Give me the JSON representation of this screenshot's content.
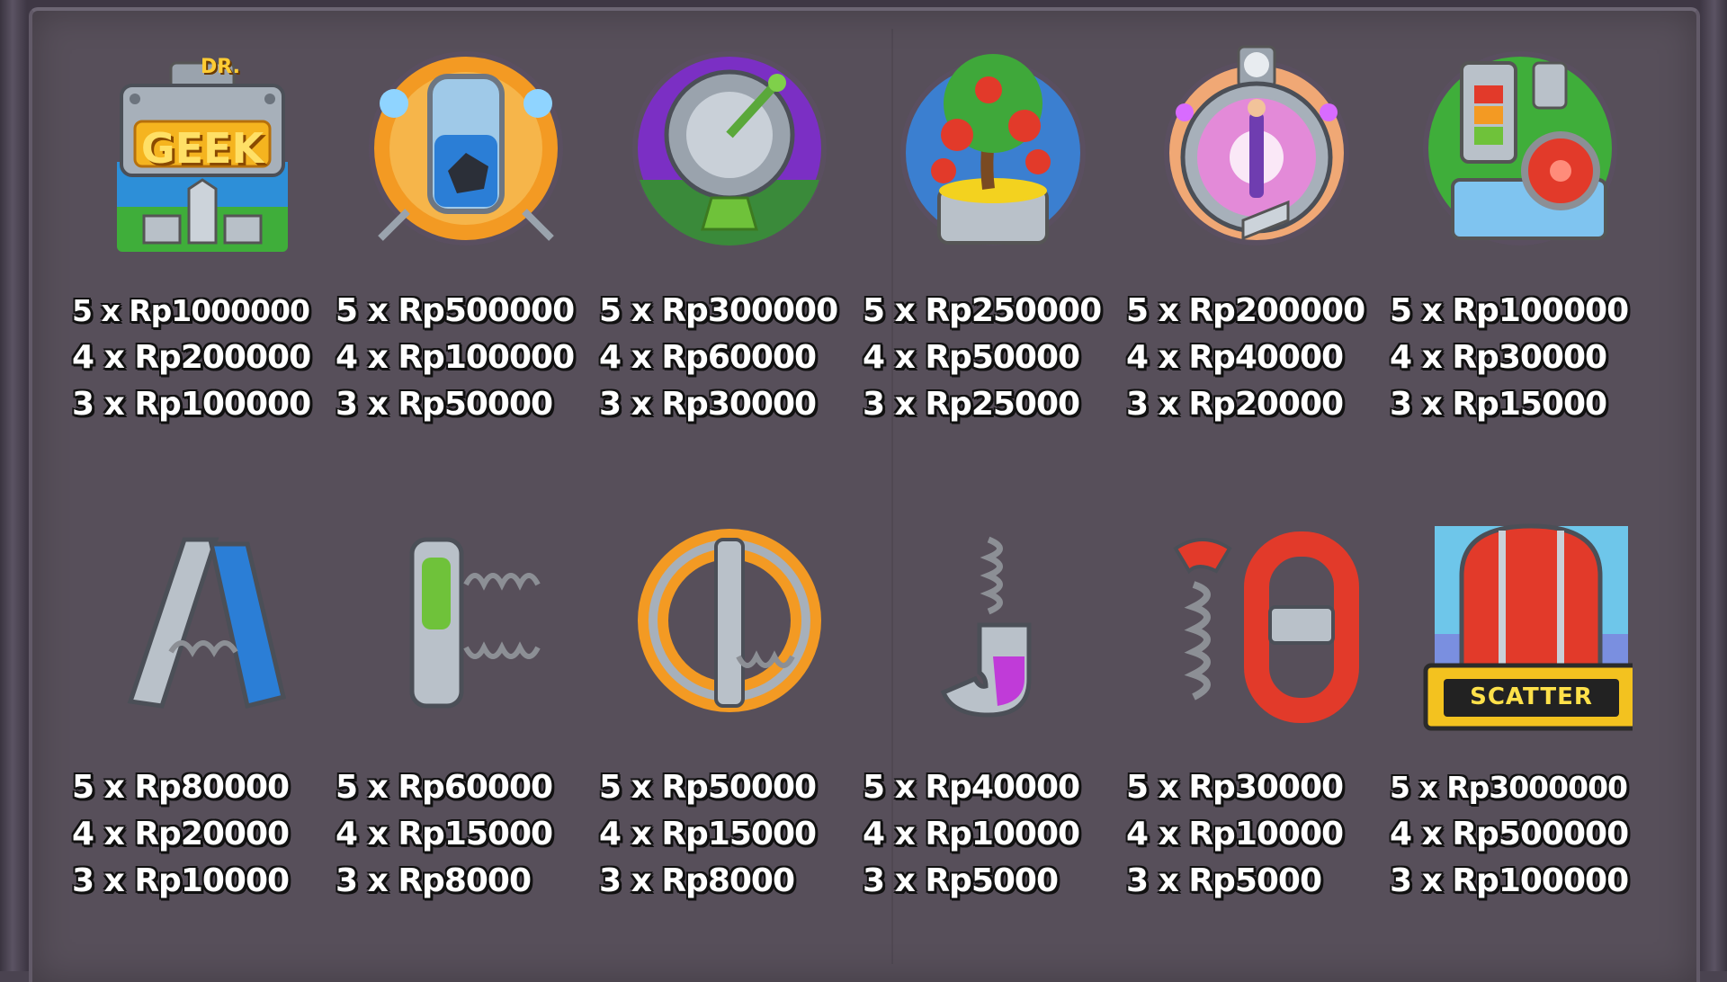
{
  "symbols_row1": [
    {
      "icon": "dr-geek-wild-icon",
      "logo_text": [
        "DR.",
        "GEEK"
      ],
      "pays": [
        "5 x Rp1000000",
        "4 x Rp200000",
        "3 x Rp100000"
      ]
    },
    {
      "icon": "specimen-jar-icon",
      "pays": [
        "5 x Rp500000",
        "4 x Rp100000",
        "3 x Rp50000"
      ]
    },
    {
      "icon": "satellite-dish-icon",
      "pays": [
        "5 x Rp300000",
        "4 x Rp60000",
        "3 x Rp30000"
      ]
    },
    {
      "icon": "tomato-plant-icon",
      "pays": [
        "5 x Rp250000",
        "4 x Rp50000",
        "3 x Rp25000"
      ]
    },
    {
      "icon": "teleporter-icon",
      "pays": [
        "5 x Rp200000",
        "4 x Rp40000",
        "3 x Rp20000"
      ]
    },
    {
      "icon": "battery-machine-icon",
      "pays": [
        "5 x Rp100000",
        "4 x Rp30000",
        "3 x Rp15000"
      ]
    }
  ],
  "symbols_row2": [
    {
      "icon": "letter-a-icon",
      "pays": [
        "5 x Rp80000",
        "4 x Rp20000",
        "3 x Rp10000"
      ]
    },
    {
      "icon": "letter-k-icon",
      "pays": [
        "5 x Rp60000",
        "4 x Rp15000",
        "3 x Rp8000"
      ]
    },
    {
      "icon": "letter-q-icon",
      "pays": [
        "5 x Rp50000",
        "4 x Rp15000",
        "3 x Rp8000"
      ]
    },
    {
      "icon": "letter-j-icon",
      "pays": [
        "5 x Rp40000",
        "4 x Rp10000",
        "3 x Rp5000"
      ]
    },
    {
      "icon": "number-10-icon",
      "pays": [
        "5 x Rp30000",
        "4 x Rp10000",
        "3 x Rp5000"
      ]
    },
    {
      "icon": "scatter-alarm-icon",
      "logo_text": [
        "SCATTER"
      ],
      "pays": [
        "5 x Rp3000000",
        "4 x Rp500000",
        "3 x Rp100000"
      ]
    }
  ]
}
